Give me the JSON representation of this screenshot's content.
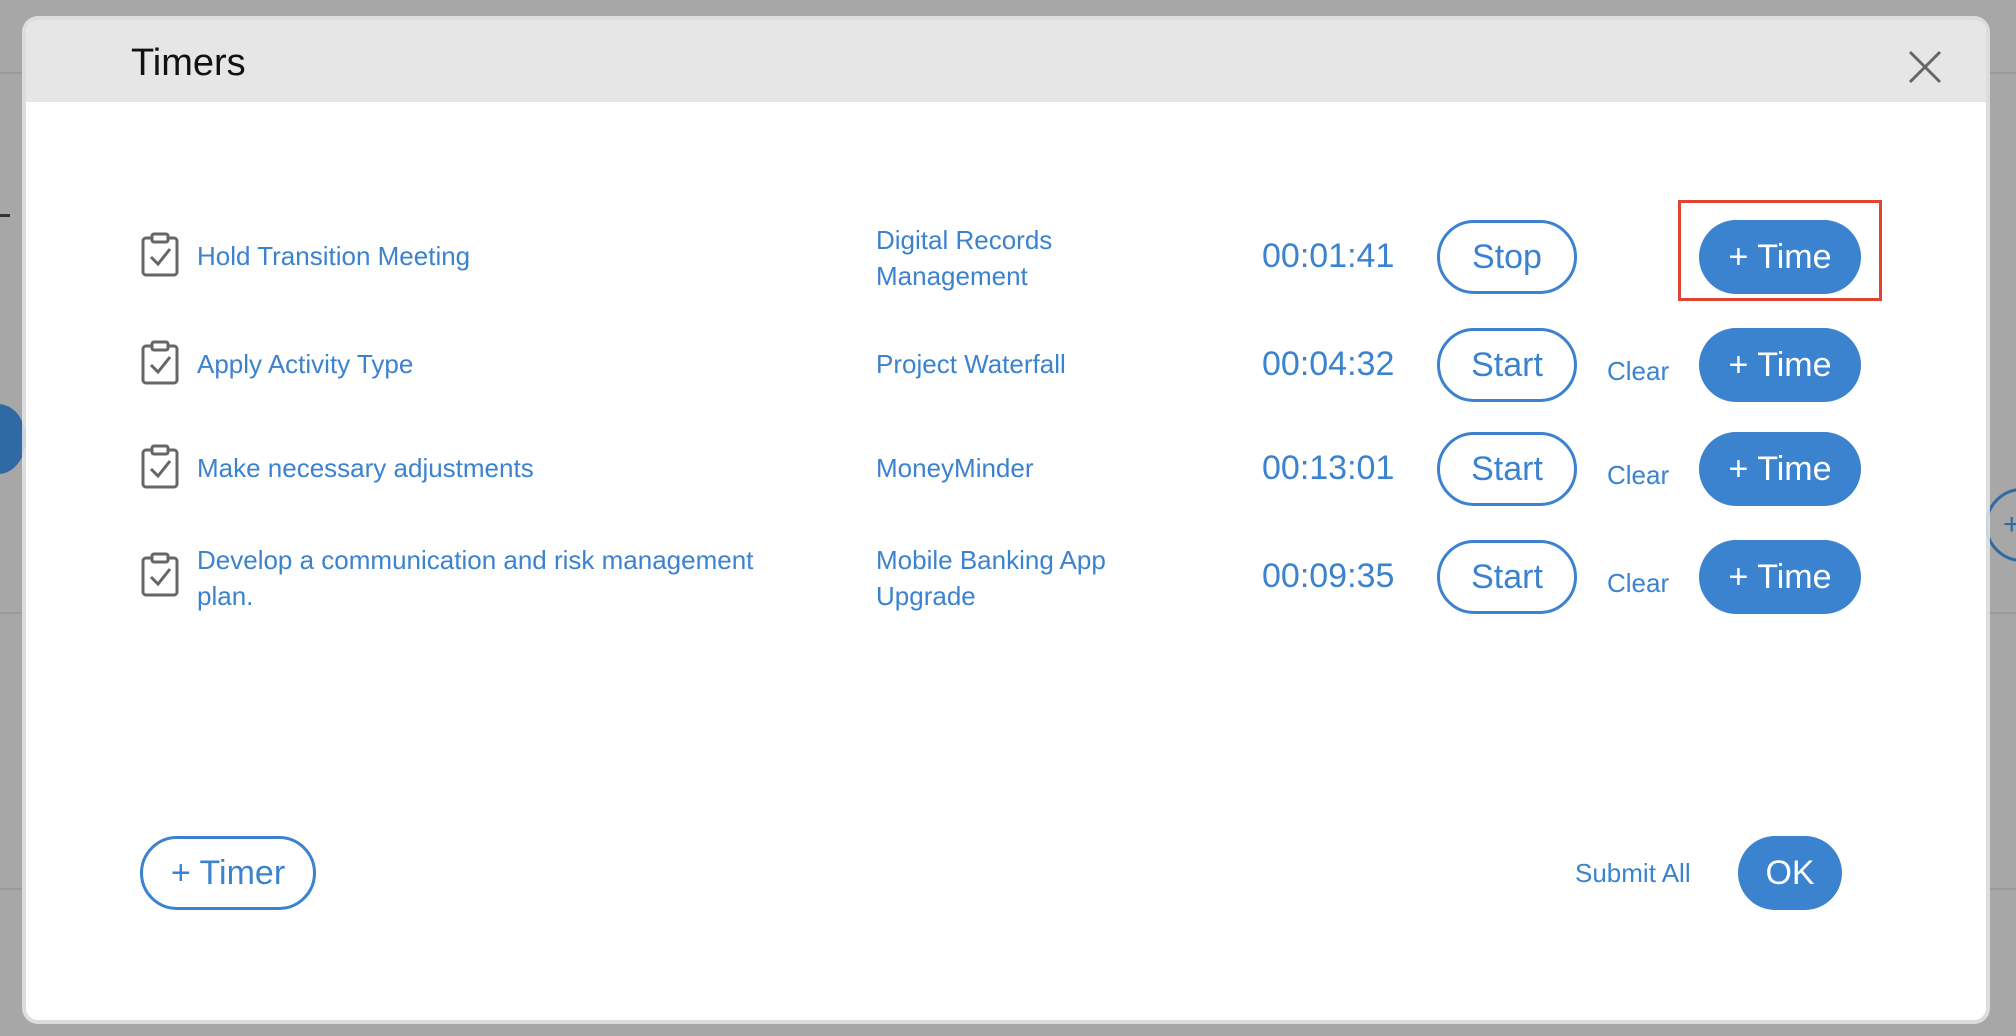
{
  "modal": {
    "title": "Timers"
  },
  "colors": {
    "accent": "#3b82cf",
    "highlight": "#e2452f",
    "header_bg": "#e6e6e6"
  },
  "icons": {
    "close": "close-icon",
    "task": "clipboard-check-icon"
  },
  "timers": [
    {
      "task": "Hold Transition Meeting",
      "project_line1": "Digital Records",
      "project_line2": "Management",
      "time": "00:01:41",
      "action": "Stop",
      "clear": "",
      "add_time": "+ Time"
    },
    {
      "task": "Apply Activity Type",
      "project_line1": "Project Waterfall",
      "project_line2": "",
      "time": "00:04:32",
      "action": "Start",
      "clear": "Clear",
      "add_time": "+ Time"
    },
    {
      "task": "Make necessary adjustments",
      "project_line1": "MoneyMinder",
      "project_line2": "",
      "time": "00:13:01",
      "action": "Start",
      "clear": "Clear",
      "add_time": "+ Time"
    },
    {
      "task_line1": "Develop a communication and risk management",
      "task_line2": "plan.",
      "project_line1": "Mobile Banking App",
      "project_line2": "Upgrade",
      "time": "00:09:35",
      "action": "Start",
      "clear": "Clear",
      "add_time": "+ Time"
    }
  ],
  "footer": {
    "add_timer": "+ Timer",
    "submit_all": "Submit All",
    "ok": "OK"
  }
}
